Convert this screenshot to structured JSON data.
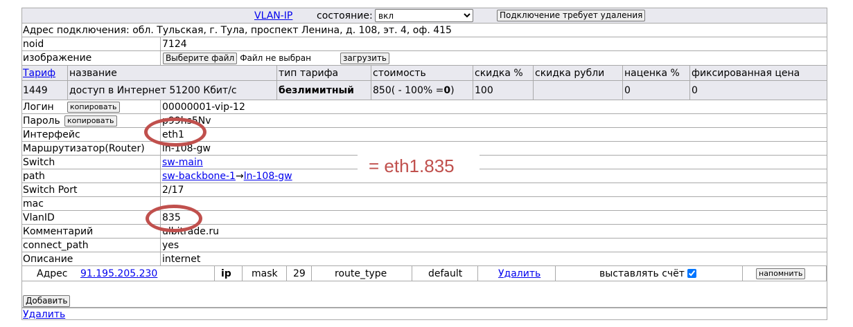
{
  "header": {
    "vlan_link": "VLAN-IP",
    "state_label": "состояние:",
    "state_value": "вкл",
    "delete_req_btn": "Подключение требует удаления"
  },
  "address_line": "Адрес подключения: обл. Тульская, г. Тула, проспект Ленина, д. 108, эт. 4, оф. 415",
  "noid": {
    "label": "noid",
    "value": "7124"
  },
  "image": {
    "label": "изображение",
    "choose_btn": "Выберите файл",
    "no_file": "Файл не выбран",
    "upload_btn": "загрузить"
  },
  "tariff_table": {
    "headers": [
      "Тариф",
      "название",
      "тип тарифа",
      "стоимость",
      "скидка %",
      "скидка рубли",
      "наценка %",
      "фиксированная цена"
    ],
    "row": {
      "id": "1449",
      "name": "доступ в Интернет 51200 Кбит/с",
      "type": "безлимитный",
      "cost_prefix": "850( - 100% = ",
      "cost_bold": "0",
      "cost_suffix": ")",
      "discount_pct": "100",
      "discount_rub": "",
      "markup_pct": "0",
      "fixed_price": "0"
    }
  },
  "fields": {
    "login": {
      "label": "Логин",
      "copy_btn": "копировать",
      "value": "00000001-vip-12"
    },
    "password": {
      "label": "Пароль",
      "copy_btn": "копировать",
      "value": "p99hs5Nv"
    },
    "interface": {
      "label": "Интерфейс",
      "value": "eth1"
    },
    "router": {
      "label": "Маршрутизатор(Router)",
      "value": "ln-108-gw"
    },
    "switch": {
      "label": "Switch",
      "value": "sw-main"
    },
    "path": {
      "label": "path",
      "link1": "sw-backbone-1",
      "arrow": "→",
      "link2": "ln-108-gw"
    },
    "switch_port": {
      "label": "Switch Port",
      "value": "2/17"
    },
    "mac": {
      "label": "mac",
      "value": ""
    },
    "vlanid": {
      "label": "VlanID",
      "value": "835"
    },
    "comment": {
      "label": "Комментарий",
      "value": "ulbitrade.ru"
    },
    "connect_path": {
      "label": "connect_path",
      "value": "yes"
    },
    "description": {
      "label": "Описание",
      "value": "internet"
    }
  },
  "address_row": {
    "label": "Адрес",
    "ip": "91.195.205.230",
    "ip_label": "ip",
    "mask_label": "mask",
    "mask_value": "29",
    "route_label": "route_type",
    "route_value": "default",
    "delete_link": "Удалить",
    "invoice_label": "выставлять счёт",
    "invoice_checked": true,
    "remind_btn": "напомнить"
  },
  "add_btn": "Добавить",
  "bottom_delete": "Удалить",
  "annotation": "= eth1.835",
  "colors": {
    "annotation": "#c0504d",
    "link": "#0000ee",
    "header_bg": "#e9e9ef",
    "border": "#a9a9a9"
  }
}
